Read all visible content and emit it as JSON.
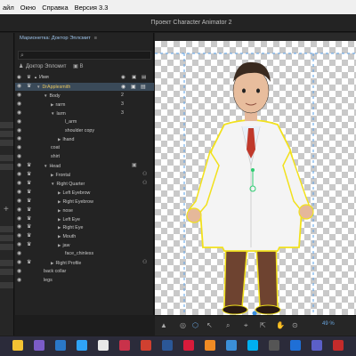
{
  "menubar": {
    "items": [
      "айл",
      "Окно",
      "Справка",
      "Версия 3.3"
    ]
  },
  "app": {
    "title": "Проект Character Animator 2"
  },
  "panel": {
    "title": "Марионетка: Доктор Эплсмит",
    "menu_icon": "≡",
    "puppet_name": "Доктор Эплсмит",
    "puppet_badge": "B",
    "column_name": "Имя"
  },
  "tree": [
    {
      "label": "DrApplesmith",
      "level": 0,
      "crown": true,
      "selected": true,
      "expand": "open"
    },
    {
      "label": "Body",
      "level": 1,
      "num": "2",
      "expand": "open"
    },
    {
      "label": "rarm",
      "level": 2,
      "num": "3",
      "expand": "closed"
    },
    {
      "label": "larm",
      "level": 2,
      "num": "3",
      "expand": "open"
    },
    {
      "label": "l_arm",
      "level": 4
    },
    {
      "label": "shoulder copy",
      "level": 4
    },
    {
      "label": "lhand",
      "level": 3,
      "expand": "closed"
    },
    {
      "label": "coat",
      "level": 2
    },
    {
      "label": "shirt",
      "level": 2
    },
    {
      "label": "Head",
      "level": 1,
      "crown": true,
      "expand": "open"
    },
    {
      "label": "Frontal",
      "level": 2,
      "crown": true,
      "expand": "closed"
    },
    {
      "label": "Right Quarter",
      "level": 2,
      "crown": true,
      "expand": "open"
    },
    {
      "label": "Left Eyebrow",
      "level": 3,
      "crown": true,
      "expand": "closed"
    },
    {
      "label": "Right Eyebrow",
      "level": 3,
      "crown": true,
      "expand": "closed"
    },
    {
      "label": "nose",
      "level": 3,
      "crown": true,
      "expand": "closed"
    },
    {
      "label": "Left Eye",
      "level": 3,
      "crown": true,
      "expand": "closed"
    },
    {
      "label": "Right Eye",
      "level": 3,
      "crown": true,
      "expand": "closed"
    },
    {
      "label": "Mouth",
      "level": 3,
      "crown": true,
      "expand": "closed"
    },
    {
      "label": "jaw",
      "level": 3,
      "crown": true,
      "expand": "closed"
    },
    {
      "label": "face_chinless",
      "level": 4
    },
    {
      "label": "Right Profile",
      "level": 2,
      "crown": true,
      "expand": "closed"
    },
    {
      "label": "back collar",
      "level": 1
    },
    {
      "label": "legs",
      "level": 1
    }
  ],
  "toolbar": {
    "tools": [
      "▲",
      "◎",
      "⬡",
      "↖",
      "⌕",
      "⌖",
      "⇱",
      "✋",
      "⊙"
    ],
    "zoom": "49 %"
  },
  "colors": {
    "selection": "#3a4a59",
    "accent_blue": "#6aa6e0",
    "outline": "#f2e11c",
    "coat": "#f4f4f4",
    "trousers": "#6e4330",
    "tie": "#c0392b"
  },
  "taskbar": {
    "apps": [
      "file-explorer",
      "viber",
      "outlook",
      "photoshop",
      "chrome",
      "media",
      "app-red",
      "word",
      "opera",
      "app-orange",
      "app-blue",
      "skype",
      "app-dark",
      "store",
      "teams",
      "app-red2"
    ]
  }
}
